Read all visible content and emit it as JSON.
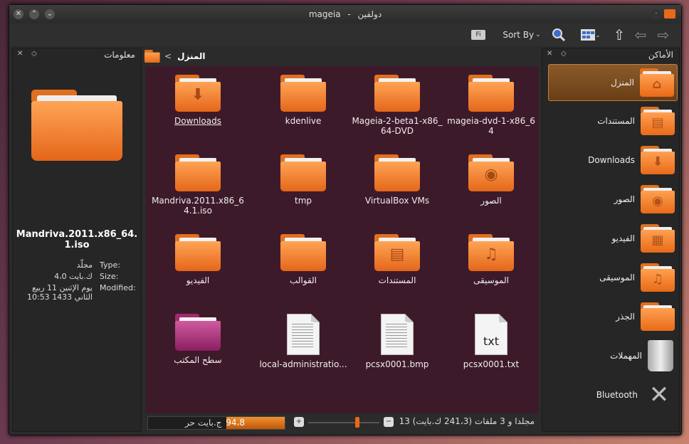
{
  "window": {
    "title_app": "mageia",
    "title_sep": "-",
    "title_name": "دولفين"
  },
  "toolbar": {
    "sort_label": "Sort By",
    "preview_label": "Fi"
  },
  "breadcrumb": {
    "current": "المنزل",
    "sep": "<"
  },
  "places_panel": {
    "title": "الأماكن",
    "items": [
      {
        "label": "المنزل",
        "selected": true,
        "emblem": "home"
      },
      {
        "label": "المستندات",
        "emblem": "doc"
      },
      {
        "label": "Downloads",
        "emblem": "download"
      },
      {
        "label": "الصور",
        "emblem": "picture"
      },
      {
        "label": "الفيديو",
        "emblem": "video"
      },
      {
        "label": "الموسيقى",
        "emblem": "music"
      },
      {
        "label": "الجذر",
        "emblem": ""
      },
      {
        "label": "المهملات",
        "emblem": "trash"
      },
      {
        "label": "Bluetooth",
        "emblem": "bluetooth"
      }
    ]
  },
  "info_panel": {
    "title": "معلومات",
    "filename": "Mandriva.2011.x86_64.1.iso",
    "type_label": "Type:",
    "size_label": "Size:",
    "modified_label": "Modified:",
    "type_value": "مجلّد",
    "size_value": "4،0 ك.بايت",
    "modified_value": "يوم الإثنين 11 ربيع الثاني 1433 10:53"
  },
  "files": [
    {
      "name": "mageia-dvd-1-x86_64",
      "kind": "folder"
    },
    {
      "name": "Mageia-2-beta1-x86_64-DVD",
      "kind": "folder"
    },
    {
      "name": "kdenlive",
      "kind": "folder"
    },
    {
      "name": "Downloads",
      "kind": "folder",
      "emblem": "download"
    },
    {
      "name": "الصور",
      "kind": "folder",
      "emblem": "picture"
    },
    {
      "name": "VirtualBox VMs",
      "kind": "folder"
    },
    {
      "name": "tmp",
      "kind": "folder"
    },
    {
      "name": "Mandriva.2011.x86_64.1.iso",
      "kind": "folder"
    },
    {
      "name": "الموسيقى",
      "kind": "folder",
      "emblem": "music"
    },
    {
      "name": "المستندات",
      "kind": "folder",
      "emblem": "doc"
    },
    {
      "name": "القوالب",
      "kind": "folder"
    },
    {
      "name": "الفيديو",
      "kind": "folder"
    },
    {
      "name": "pcsx0001.txt",
      "kind": "text"
    },
    {
      "name": "pcsx0001.bmp",
      "kind": "doc"
    },
    {
      "name": "local-administratio...",
      "kind": "doc"
    },
    {
      "name": "سطح المكتب",
      "kind": "desktop"
    }
  ],
  "status": {
    "summary": "13 مجلدا و 3 ملفات (241،3 ك.بايت)",
    "free_value": "94،8",
    "free_label": "ج.بايت حر"
  },
  "colors": {
    "accent": "#e86a18",
    "view_bg": "#3d1a2a",
    "selection": "#8a5a2a"
  }
}
